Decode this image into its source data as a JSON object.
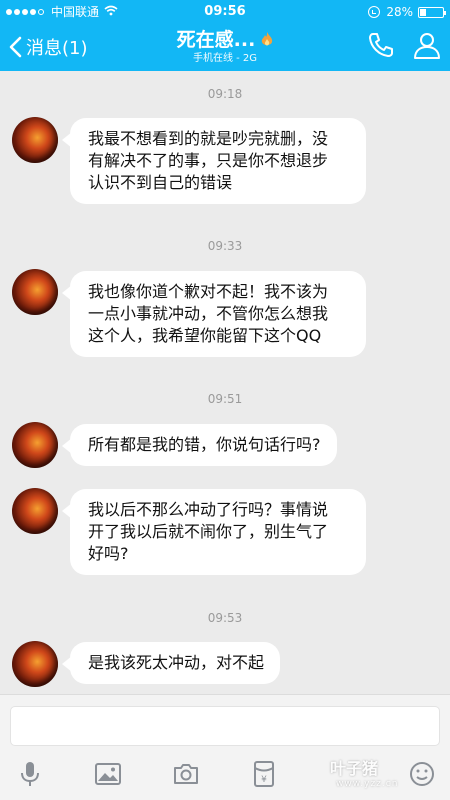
{
  "status_bar": {
    "carrier": "中国联通",
    "time": "09:56",
    "battery_text": "28%",
    "battery_level": 0.28,
    "signal_dots_filled": 4,
    "signal_dots_total": 5
  },
  "nav": {
    "back_label": "消息(1)",
    "title": "死在感...",
    "subtitle": "手机在线 - 2G",
    "accent_color": "#12b7f5"
  },
  "messages": [
    {
      "timestamp": "09:18",
      "text_lines": [
        "我最不想看到的就是吵完就删，没",
        "有解决不了的事，只是你不想退步",
        "认识不到自己的错误"
      ]
    },
    {
      "timestamp": "09:33",
      "text_lines": [
        "我也像你道个歉对不起！我不该为",
        "一点小事就冲动，不管你怎么想我",
        "这个人，我希望你能留下这个QQ"
      ]
    },
    {
      "timestamp": "09:51",
      "text_lines": [
        "所有都是我的错，你说句话行吗?"
      ]
    },
    {
      "timestamp": "",
      "text_lines": [
        "我以后不那么冲动了行吗？事情说",
        "开了我以后就不闹你了，别生气了",
        "好吗?"
      ]
    },
    {
      "timestamp": "09:53",
      "text_lines": [
        "是我该死太冲动，对不起"
      ]
    }
  ],
  "input": {
    "value": ""
  },
  "toolbar": {
    "icons": [
      "microphone-icon",
      "image-icon",
      "camera-icon",
      "red-packet-icon",
      "emoji-icon"
    ]
  },
  "watermark": {
    "main": "叶子猪",
    "sub": "www.yzz.cn"
  }
}
